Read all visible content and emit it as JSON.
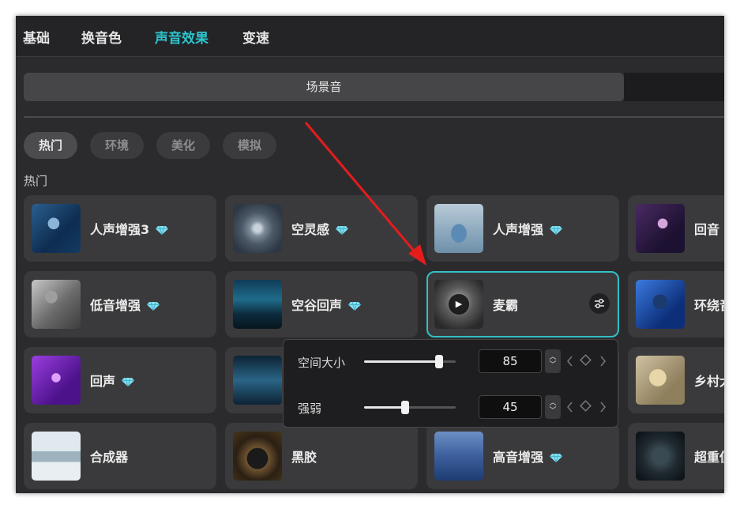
{
  "tabs": [
    {
      "label": "基础"
    },
    {
      "label": "换音色"
    },
    {
      "label": "声音效果"
    },
    {
      "label": "变速"
    }
  ],
  "active_tab": "声音效果",
  "segment": {
    "label": "场景音"
  },
  "categories": [
    {
      "label": "热门"
    },
    {
      "label": "环境"
    },
    {
      "label": "美化"
    },
    {
      "label": "模拟"
    }
  ],
  "section_title": "热门",
  "effects": [
    {
      "label": "人声增强3",
      "premium": true
    },
    {
      "label": "空灵感",
      "premium": true
    },
    {
      "label": "人声增强",
      "premium": true
    },
    {
      "label": "回音",
      "premium": false
    },
    {
      "label": "低音增强",
      "premium": true
    },
    {
      "label": "空谷回声",
      "premium": true
    },
    {
      "label": "麦霸",
      "premium": false,
      "selected": true
    },
    {
      "label": "环绕音",
      "premium": false
    },
    {
      "label": "回声",
      "premium": true
    },
    {
      "label": "",
      "premium": false
    },
    {
      "label": "",
      "premium": false
    },
    {
      "label": "乡村大喇叭",
      "premium": false
    },
    {
      "label": "合成器",
      "premium": false
    },
    {
      "label": "黑胶",
      "premium": false
    },
    {
      "label": "高音增强",
      "premium": true
    },
    {
      "label": "超重低音",
      "premium": false
    }
  ],
  "params": {
    "space": {
      "label": "空间大小",
      "value": "85",
      "fraction": 0.82
    },
    "strength": {
      "label": "强弱",
      "value": "45",
      "fraction": 0.45
    }
  },
  "colors": {
    "accent": "#2dc5cf",
    "annotation_arrow": "#e51c1c",
    "gem": "#7fdff0"
  }
}
